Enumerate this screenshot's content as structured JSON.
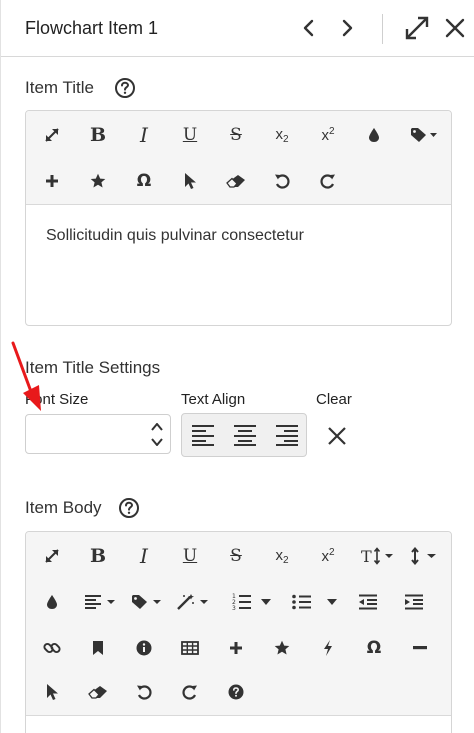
{
  "header": {
    "title": "Flowchart Item 1",
    "prev_icon": "chevron-left-icon",
    "next_icon": "chevron-right-icon",
    "expand_icon": "expand-arrows-icon",
    "close_icon": "close-icon"
  },
  "item_title": {
    "label": "Item Title",
    "help_icon": "question-circle-icon",
    "toolbar_row1": [
      "expand",
      "bold",
      "italic",
      "underline",
      "strikethrough",
      "subscript",
      "superscript",
      "text-color",
      "tag-dropdown"
    ],
    "toolbar_row2": [
      "plus",
      "star",
      "omega",
      "cursor",
      "eraser",
      "undo",
      "redo"
    ],
    "bold_label": "B",
    "italic_label": "I",
    "underline_label": "U",
    "strike_label": "S",
    "sub_label": "x",
    "sub_small": "2",
    "sup_label": "x",
    "sup_small": "2",
    "omega_label": "Ω",
    "content": "Sollicitudin quis pulvinar consectetur"
  },
  "settings": {
    "label": "Item Title Settings",
    "font_size_label": "Font Size",
    "font_size_value": "",
    "text_align_label": "Text Align",
    "clear_label": "Clear"
  },
  "item_body": {
    "label": "Item Body",
    "help_icon": "question-circle-icon",
    "bold_label": "B",
    "italic_label": "I",
    "underline_label": "U",
    "strike_label": "S",
    "sub_label": "x",
    "sub_small": "2",
    "sup_label": "x",
    "sup_small": "2",
    "font_size_label": "T",
    "omega_label": "Ω"
  },
  "annotation": {
    "arrow_color": "#e8191b"
  }
}
